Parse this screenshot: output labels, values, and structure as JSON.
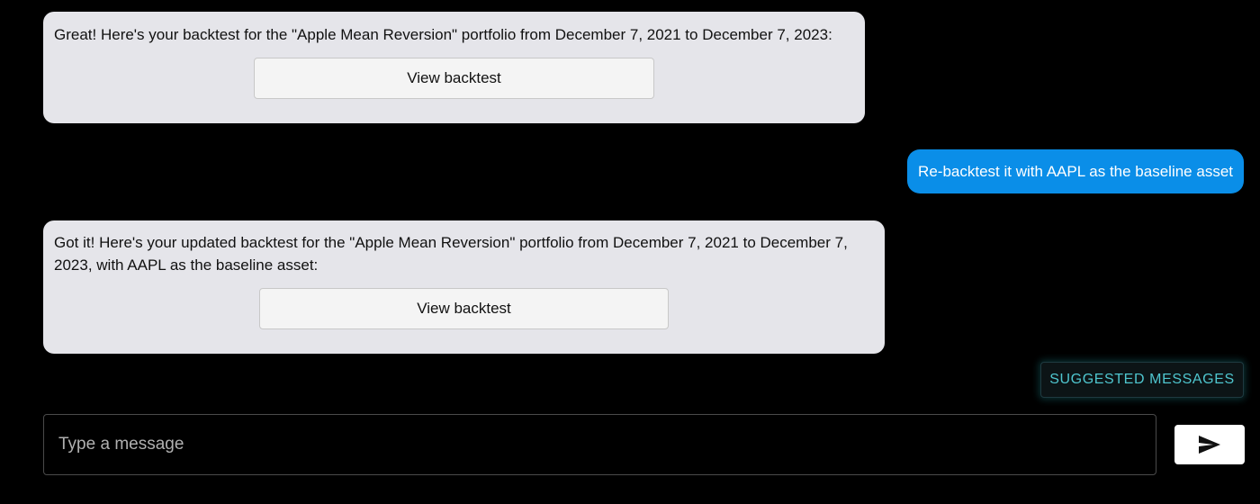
{
  "messages": [
    {
      "sender": "assistant",
      "text": "Great! Here's your backtest for the \"Apple Mean Reversion\" portfolio from December 7, 2021 to December 7, 2023:",
      "button_label": "View backtest"
    },
    {
      "sender": "user",
      "text": "Re-backtest it with AAPL as the baseline asset"
    },
    {
      "sender": "assistant",
      "text": "Got it! Here's your updated backtest for the \"Apple Mean Reversion\" portfolio from December 7, 2021 to December 7, 2023, with AAPL as the baseline asset:",
      "button_label": "View backtest"
    }
  ],
  "suggested_messages_label": "SUGGESTED MESSAGES",
  "composer": {
    "placeholder": "Type a message",
    "value": ""
  },
  "send_icon": "send-icon",
  "colors": {
    "background": "#000000",
    "assistant_bubble": "#e5e5ea",
    "user_bubble": "#0a8ee8",
    "suggested_accent": "#4fc6cf"
  }
}
